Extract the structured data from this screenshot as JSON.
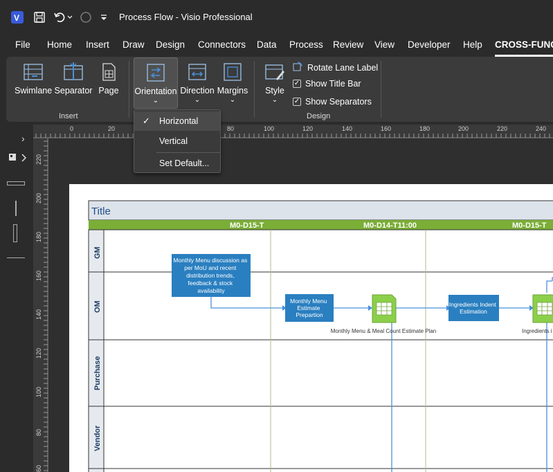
{
  "window": {
    "title": "Process Flow  -  Visio Professional"
  },
  "menu": {
    "tabs": [
      "File",
      "Home",
      "Insert",
      "Draw",
      "Design",
      "Connectors",
      "Data",
      "Process",
      "Review",
      "View",
      "Developer",
      "Help",
      "CROSS-FUNCT"
    ]
  },
  "ribbon": {
    "insert_group": {
      "label": "Insert",
      "buttons": [
        "Swimlane",
        "Separator",
        "Page"
      ]
    },
    "layout_buttons": [
      "Orientation",
      "Direction",
      "Margins"
    ],
    "design_group": {
      "label": "Design",
      "style_label": "Style",
      "rotate_lane_label": "Rotate Lane Label",
      "show_title_bar": "Show Title Bar",
      "show_separators": "Show Separators"
    }
  },
  "orientation_menu": {
    "items": [
      "Horizontal",
      "Vertical",
      "Set Default..."
    ],
    "selected": "Horizontal"
  },
  "ruler": {
    "top_labels": [
      "0",
      "20",
      "80",
      "100",
      "120",
      "140",
      "160",
      "180",
      "200",
      "220",
      "240"
    ],
    "left_labels": [
      "220",
      "200",
      "180",
      "160",
      "140",
      "120",
      "100",
      "80",
      "60"
    ]
  },
  "diagram": {
    "title": "Title",
    "phases": [
      "M0-D15-T",
      "M0-D14-T11:00",
      "M0-D15-T"
    ],
    "lanes": [
      "GM",
      "OM",
      "Purchase",
      "Vendor"
    ],
    "shapes": {
      "process1_lines": [
        "Monthly Menu discussion as",
        "per MoU and recent",
        "distribution trends,",
        "feedback & stock",
        "availability"
      ],
      "process2_lines": [
        "Monthly Menu",
        "Estimate",
        "Prepartion"
      ],
      "process3_lines": [
        "Ingredients Indent",
        "Estimation"
      ],
      "doc1_label": "Monthly Menu & Meal Count Estimate Plan",
      "doc2_label": "Ingredients i"
    },
    "colors": {
      "phase_bar": "#7aae36",
      "process_fill": "#2a7fc0",
      "doc_fill": "#8ccf4a",
      "connector": "#4a90d9"
    }
  }
}
